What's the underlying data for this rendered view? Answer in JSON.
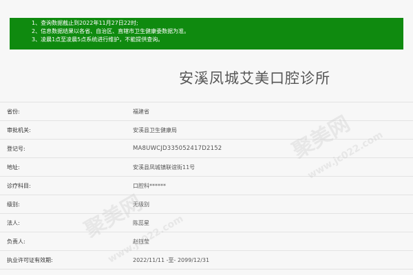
{
  "notice": {
    "lines": [
      "1、查询数据截止到2022年11月27日22时;",
      "2、信息数据结果以各省、自治区、直辖市卫生健康委数据为准。",
      "3、凌晨1点至凌晨5点系统进行维护，不能提供查询。"
    ]
  },
  "clinic": {
    "name": "安溪凤城艾美口腔诊所"
  },
  "details": [
    {
      "label": "省份:",
      "value": "福建省"
    },
    {
      "label": "审批机关:",
      "value": "安溪县卫生健康局"
    },
    {
      "label": "登记号:",
      "value": "MA8UWCJD335052417D2152"
    },
    {
      "label": "地址:",
      "value": "安溪县凤城镇联谊街11号"
    },
    {
      "label": "诊疗科目:",
      "value": "口腔科******"
    },
    {
      "label": "级别:",
      "value": "无级别"
    },
    {
      "label": "法人:",
      "value": "陈蕊星"
    },
    {
      "label": "负责人:",
      "value": "赵钰莹"
    },
    {
      "label": "执业许可证有效期:",
      "value": "2022/11/11 -至- 2099/12/31"
    }
  ],
  "watermark": {
    "text": "聚美网",
    "url": "www.jc022.com"
  }
}
